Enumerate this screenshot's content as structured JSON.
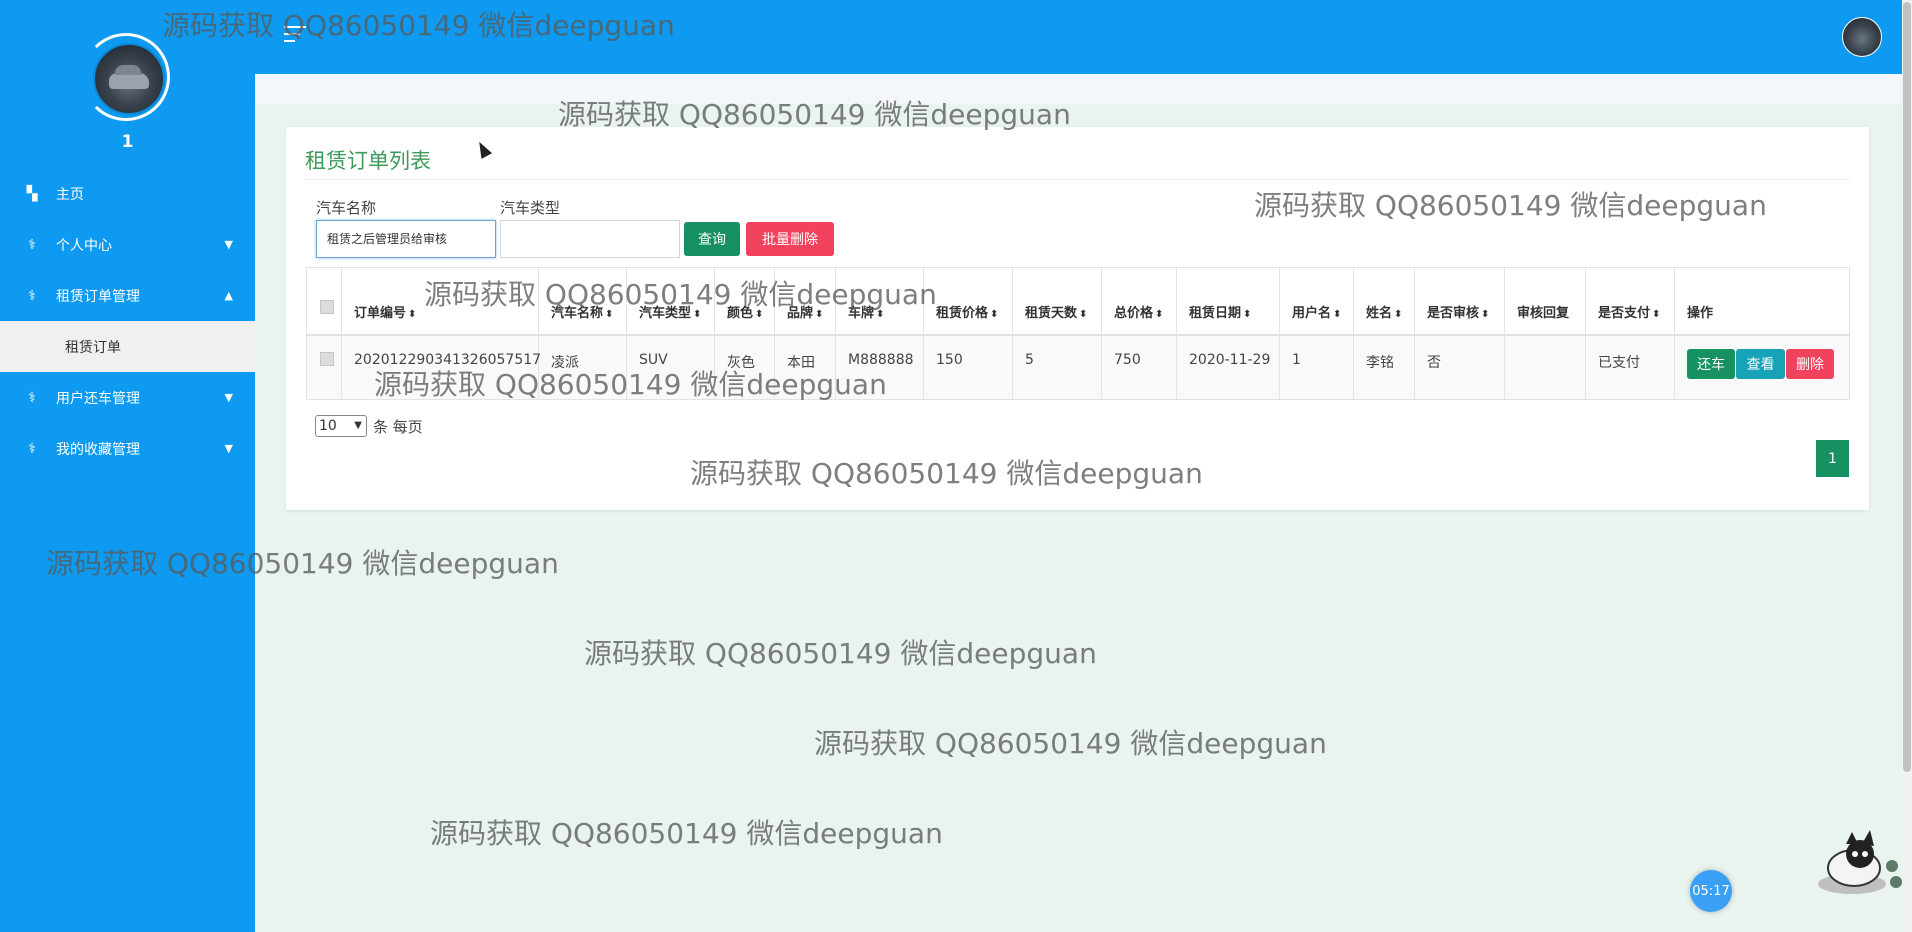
{
  "sidebar": {
    "user_number": "1",
    "items": [
      {
        "label": "主页",
        "icon": "home-icon",
        "has_chevron": false
      },
      {
        "label": "个人中心",
        "icon": "stethoscope-icon",
        "chevron": "⌄"
      },
      {
        "label": "租赁订单管理",
        "icon": "stethoscope-icon",
        "chevron": "⌃",
        "expanded": true
      },
      {
        "label": "用户还车管理",
        "icon": "stethoscope-icon",
        "chevron": "⌄"
      },
      {
        "label": "我的收藏管理",
        "icon": "stethoscope-icon",
        "chevron": "⌄"
      }
    ],
    "submenu": {
      "label": "租赁订单"
    }
  },
  "header": {
    "menu_icon": "hamburger-icon",
    "avatar_icon": "user-avatar-icon"
  },
  "card": {
    "title": "租赁订单列表",
    "search": {
      "car_name_label": "汽车名称",
      "car_name_value": "租赁之后管理员给审核",
      "car_type_label": "汽车类型",
      "car_type_value": "",
      "query_label": "查询",
      "batch_delete_label": "批量删除"
    },
    "table": {
      "columns": [
        "订单编号",
        "汽车名称",
        "汽车类型",
        "颜色",
        "品牌",
        "车牌",
        "租赁价格",
        "租赁天数",
        "总价格",
        "租赁日期",
        "用户名",
        "姓名",
        "是否审核",
        "审核回复",
        "是否支付",
        "操作"
      ],
      "rows": [
        [
          "202012290341326057517",
          "凌派",
          "SUV",
          "灰色",
          "本田",
          "M888888",
          "150",
          "5",
          "750",
          "2020-11-29",
          "1",
          "李铭",
          "否",
          "",
          "已支付"
        ]
      ],
      "actions": {
        "return_label": "还车",
        "view_label": "查看",
        "delete_label": "删除"
      }
    },
    "pager": {
      "per_page_value": "10",
      "per_page_text": "条 每页",
      "current_page": "1"
    }
  },
  "watermark": "源码获取 QQ86050149 微信deepguan",
  "timer": "05:17",
  "colors": {
    "primary": "#0d9af0",
    "green": "#179162",
    "red": "#f2435e",
    "title_green": "#3d9a5a"
  }
}
